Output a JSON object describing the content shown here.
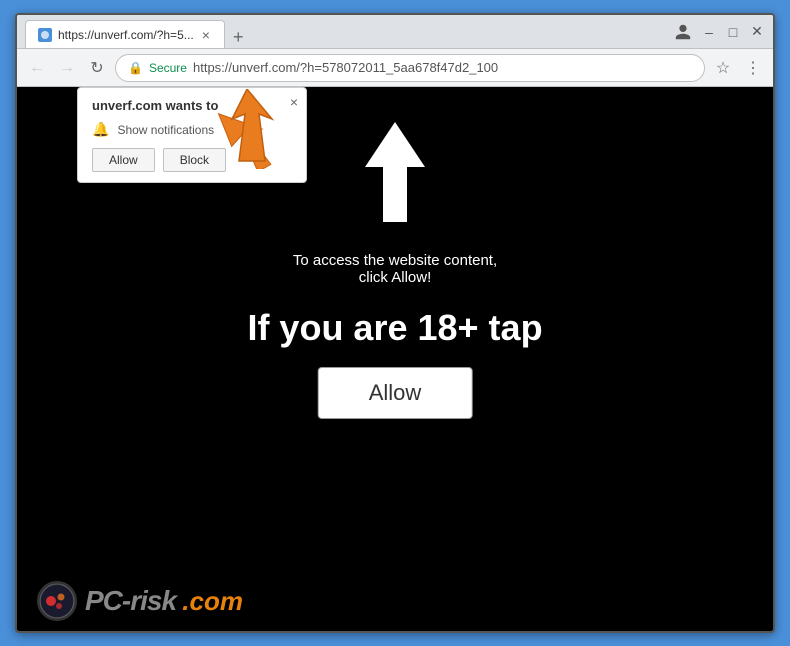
{
  "browser": {
    "tab": {
      "title": "https://unverf.com/?h=5...",
      "favicon_color": "#4a90d9"
    },
    "address_bar": {
      "secure_label": "Secure",
      "url": "https://unverf.com/?h=578072011_5aa678f47d2_100",
      "back_btn": "←",
      "forward_btn": "→",
      "refresh_btn": "↻"
    }
  },
  "notification_popup": {
    "title": "unverf.com wants to",
    "close_btn": "×",
    "row_text": "Show notifications",
    "allow_btn": "Allow",
    "block_btn": "Block"
  },
  "page": {
    "up_arrow_color": "#ffffff",
    "instruction_line1": "To access the website content,",
    "instruction_line2": "click Allow!",
    "main_text": "If you are 18+ tap",
    "allow_btn": "Allow"
  },
  "pcrisk": {
    "pc_text": "PC",
    "dash_text": "-",
    "risk_text": "risk",
    "com_text": ".com"
  },
  "icons": {
    "back": "←",
    "forward": "→",
    "refresh": "↻",
    "star": "☆",
    "menu": "⋮",
    "close": "×",
    "bell": "🔔",
    "user": "👤",
    "secure": "🔒"
  }
}
